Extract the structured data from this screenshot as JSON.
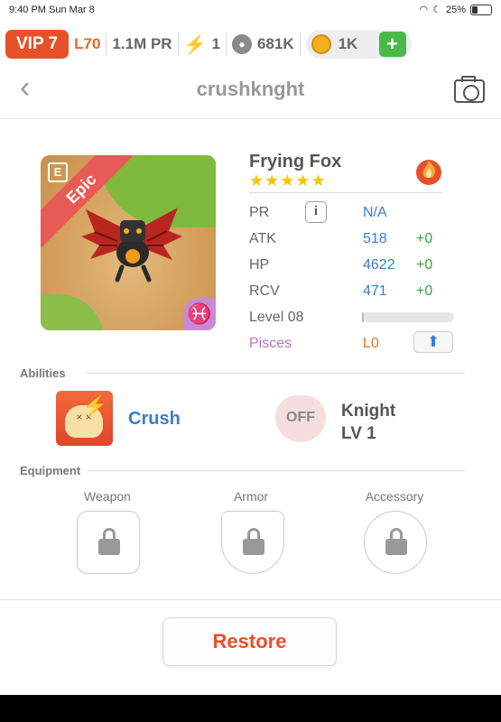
{
  "status_bar": {
    "time_date": "9:40 PM  Sun Mar 8",
    "battery": "25%"
  },
  "currency_bar": {
    "vip": "VIP 7",
    "level": "L70",
    "power": "1.1M PR",
    "energy": "1",
    "paw_points": "681K",
    "coins": "1K",
    "add": "+"
  },
  "header": {
    "title": "crushknght",
    "back": "‹"
  },
  "pet": {
    "rarity": "Epic",
    "name": "Frying Fox",
    "stars": "★★★★★",
    "rarity_color": "#e85a55",
    "element_color": "#e8502a",
    "stats": [
      {
        "label": "PR",
        "value": "N/A",
        "delta": ""
      },
      {
        "label": "ATK",
        "value": "518",
        "delta": "+0"
      },
      {
        "label": "HP",
        "value": "4622",
        "delta": "+0"
      },
      {
        "label": "RCV",
        "value": "471",
        "delta": "+0"
      }
    ],
    "level_label": "Level 08",
    "level_progress": 0.02,
    "sign_label": "Pisces",
    "sign_symbol": "♓",
    "sign_level": "L0",
    "sign_color": "#c26fc9"
  },
  "abilities": {
    "heading": "Abilities",
    "primary": {
      "name": "Crush"
    },
    "secondary": {
      "state": "OFF",
      "name_line1": "Knight",
      "name_line2": "LV 1"
    }
  },
  "equipment": {
    "heading": "Equipment",
    "slots": [
      {
        "label": "Weapon"
      },
      {
        "label": "Armor"
      },
      {
        "label": "Accessory"
      }
    ]
  },
  "footer": {
    "restore": "Restore"
  }
}
